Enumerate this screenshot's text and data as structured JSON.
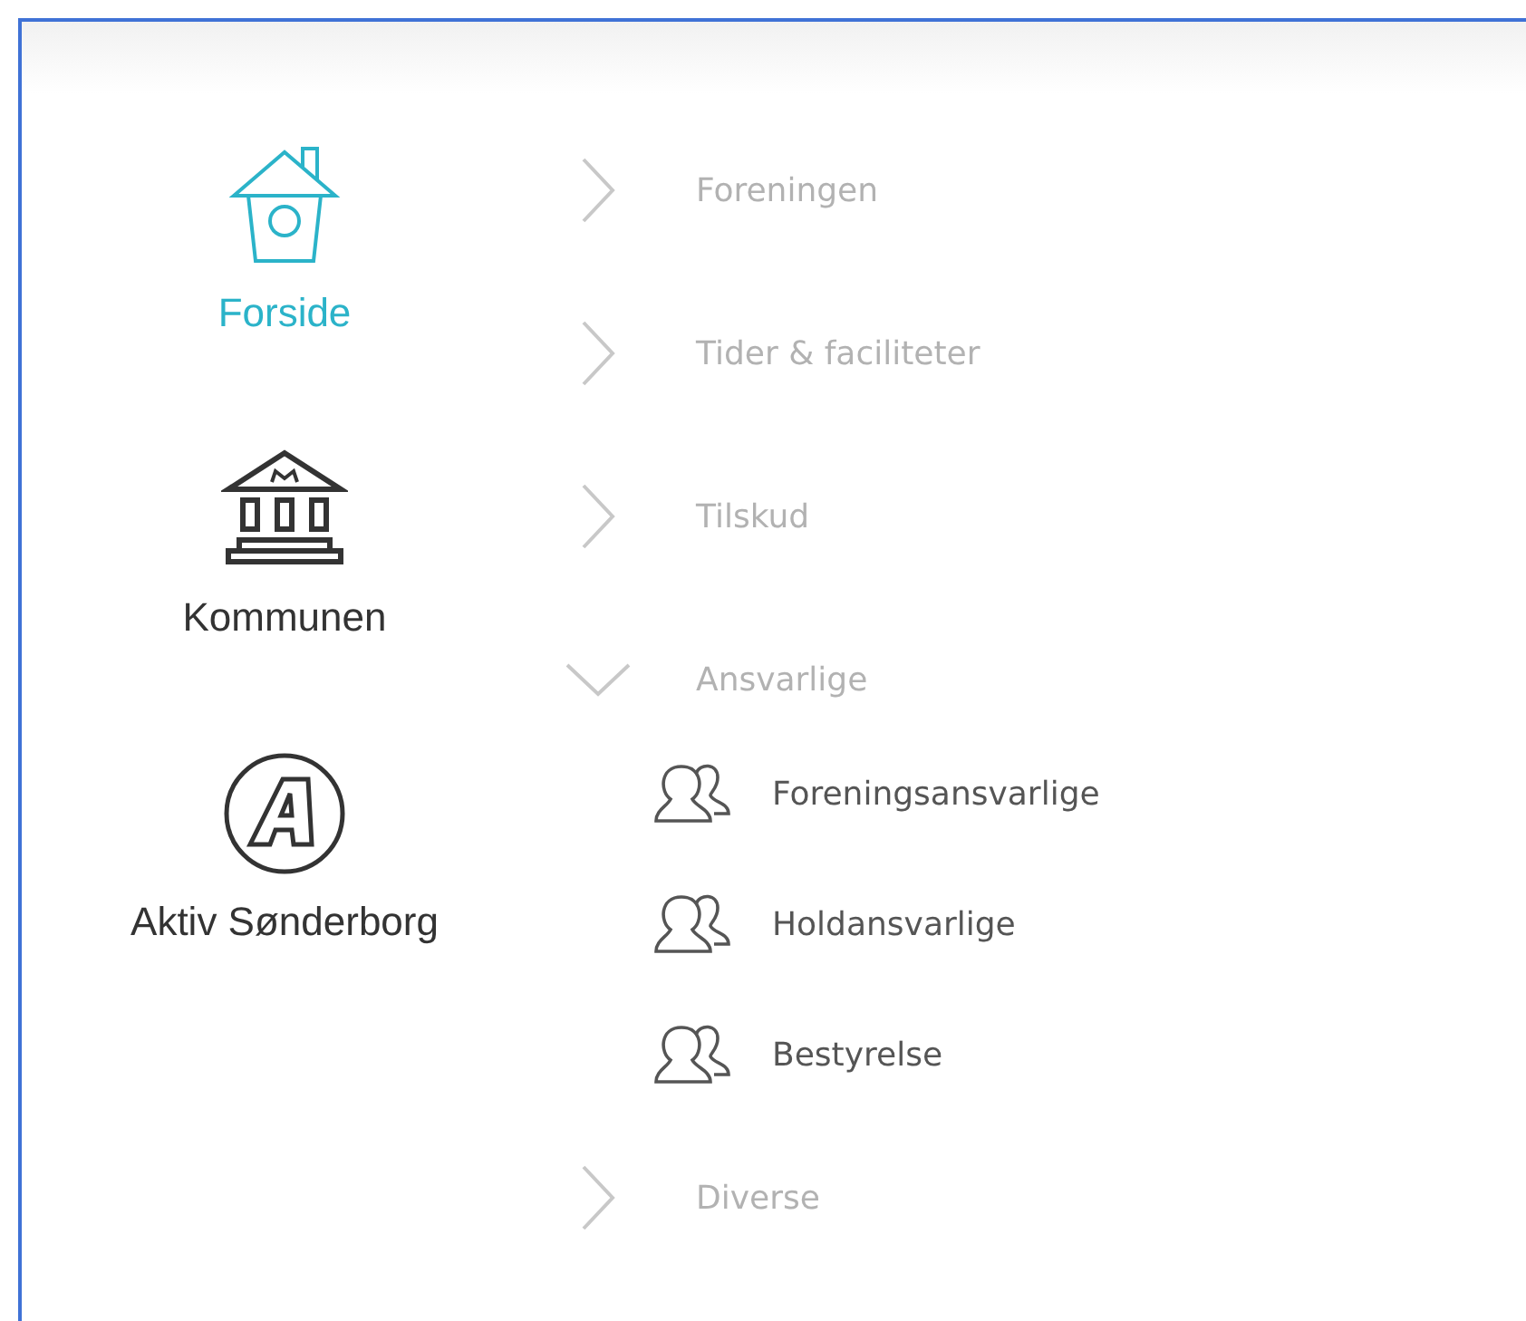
{
  "sidebar": {
    "items": [
      {
        "label": "Forside",
        "kind": "house",
        "selected": true
      },
      {
        "label": "Kommunen",
        "kind": "townhall",
        "selected": false
      },
      {
        "label": "Aktiv Sønderborg",
        "kind": "badge",
        "selected": false
      }
    ]
  },
  "menu": {
    "items": [
      {
        "label": "Foreningen",
        "expanded": false
      },
      {
        "label": "Tider & faciliteter",
        "expanded": false
      },
      {
        "label": "Tilskud",
        "expanded": false
      },
      {
        "label": "Ansvarlige",
        "expanded": true,
        "children": [
          {
            "label": "Foreningsansvarlige"
          },
          {
            "label": "Holdansvarlige"
          },
          {
            "label": "Bestyrelse"
          }
        ]
      },
      {
        "label": "Diverse",
        "expanded": false
      }
    ]
  }
}
